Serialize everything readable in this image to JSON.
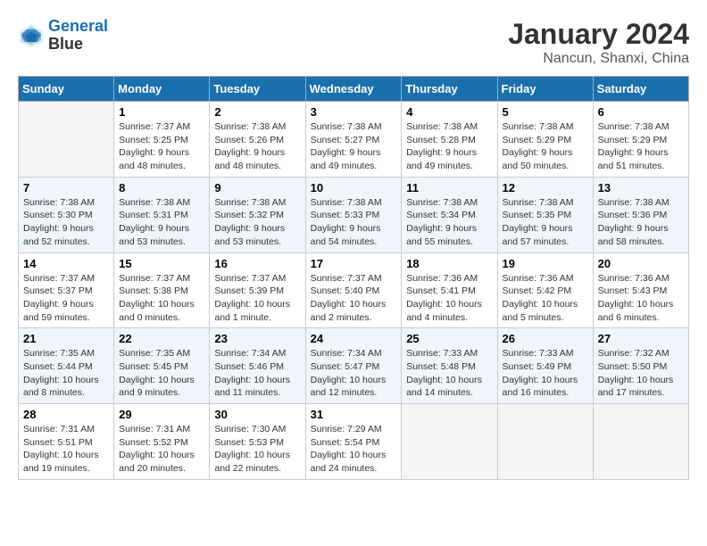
{
  "header": {
    "logo_line1": "General",
    "logo_line2": "Blue",
    "month_year": "January 2024",
    "location": "Nancun, Shanxi, China"
  },
  "days_of_week": [
    "Sunday",
    "Monday",
    "Tuesday",
    "Wednesday",
    "Thursday",
    "Friday",
    "Saturday"
  ],
  "weeks": [
    [
      {
        "day": "",
        "sunrise": "",
        "sunset": "",
        "daylight": "",
        "empty": true
      },
      {
        "day": "1",
        "sunrise": "Sunrise: 7:37 AM",
        "sunset": "Sunset: 5:25 PM",
        "daylight": "Daylight: 9 hours and 48 minutes."
      },
      {
        "day": "2",
        "sunrise": "Sunrise: 7:38 AM",
        "sunset": "Sunset: 5:26 PM",
        "daylight": "Daylight: 9 hours and 48 minutes."
      },
      {
        "day": "3",
        "sunrise": "Sunrise: 7:38 AM",
        "sunset": "Sunset: 5:27 PM",
        "daylight": "Daylight: 9 hours and 49 minutes."
      },
      {
        "day": "4",
        "sunrise": "Sunrise: 7:38 AM",
        "sunset": "Sunset: 5:28 PM",
        "daylight": "Daylight: 9 hours and 49 minutes."
      },
      {
        "day": "5",
        "sunrise": "Sunrise: 7:38 AM",
        "sunset": "Sunset: 5:29 PM",
        "daylight": "Daylight: 9 hours and 50 minutes."
      },
      {
        "day": "6",
        "sunrise": "Sunrise: 7:38 AM",
        "sunset": "Sunset: 5:29 PM",
        "daylight": "Daylight: 9 hours and 51 minutes."
      }
    ],
    [
      {
        "day": "7",
        "sunrise": "Sunrise: 7:38 AM",
        "sunset": "Sunset: 5:30 PM",
        "daylight": "Daylight: 9 hours and 52 minutes."
      },
      {
        "day": "8",
        "sunrise": "Sunrise: 7:38 AM",
        "sunset": "Sunset: 5:31 PM",
        "daylight": "Daylight: 9 hours and 53 minutes."
      },
      {
        "day": "9",
        "sunrise": "Sunrise: 7:38 AM",
        "sunset": "Sunset: 5:32 PM",
        "daylight": "Daylight: 9 hours and 53 minutes."
      },
      {
        "day": "10",
        "sunrise": "Sunrise: 7:38 AM",
        "sunset": "Sunset: 5:33 PM",
        "daylight": "Daylight: 9 hours and 54 minutes."
      },
      {
        "day": "11",
        "sunrise": "Sunrise: 7:38 AM",
        "sunset": "Sunset: 5:34 PM",
        "daylight": "Daylight: 9 hours and 55 minutes."
      },
      {
        "day": "12",
        "sunrise": "Sunrise: 7:38 AM",
        "sunset": "Sunset: 5:35 PM",
        "daylight": "Daylight: 9 hours and 57 minutes."
      },
      {
        "day": "13",
        "sunrise": "Sunrise: 7:38 AM",
        "sunset": "Sunset: 5:36 PM",
        "daylight": "Daylight: 9 hours and 58 minutes."
      }
    ],
    [
      {
        "day": "14",
        "sunrise": "Sunrise: 7:37 AM",
        "sunset": "Sunset: 5:37 PM",
        "daylight": "Daylight: 9 hours and 59 minutes."
      },
      {
        "day": "15",
        "sunrise": "Sunrise: 7:37 AM",
        "sunset": "Sunset: 5:38 PM",
        "daylight": "Daylight: 10 hours and 0 minutes."
      },
      {
        "day": "16",
        "sunrise": "Sunrise: 7:37 AM",
        "sunset": "Sunset: 5:39 PM",
        "daylight": "Daylight: 10 hours and 1 minute."
      },
      {
        "day": "17",
        "sunrise": "Sunrise: 7:37 AM",
        "sunset": "Sunset: 5:40 PM",
        "daylight": "Daylight: 10 hours and 2 minutes."
      },
      {
        "day": "18",
        "sunrise": "Sunrise: 7:36 AM",
        "sunset": "Sunset: 5:41 PM",
        "daylight": "Daylight: 10 hours and 4 minutes."
      },
      {
        "day": "19",
        "sunrise": "Sunrise: 7:36 AM",
        "sunset": "Sunset: 5:42 PM",
        "daylight": "Daylight: 10 hours and 5 minutes."
      },
      {
        "day": "20",
        "sunrise": "Sunrise: 7:36 AM",
        "sunset": "Sunset: 5:43 PM",
        "daylight": "Daylight: 10 hours and 6 minutes."
      }
    ],
    [
      {
        "day": "21",
        "sunrise": "Sunrise: 7:35 AM",
        "sunset": "Sunset: 5:44 PM",
        "daylight": "Daylight: 10 hours and 8 minutes."
      },
      {
        "day": "22",
        "sunrise": "Sunrise: 7:35 AM",
        "sunset": "Sunset: 5:45 PM",
        "daylight": "Daylight: 10 hours and 9 minutes."
      },
      {
        "day": "23",
        "sunrise": "Sunrise: 7:34 AM",
        "sunset": "Sunset: 5:46 PM",
        "daylight": "Daylight: 10 hours and 11 minutes."
      },
      {
        "day": "24",
        "sunrise": "Sunrise: 7:34 AM",
        "sunset": "Sunset: 5:47 PM",
        "daylight": "Daylight: 10 hours and 12 minutes."
      },
      {
        "day": "25",
        "sunrise": "Sunrise: 7:33 AM",
        "sunset": "Sunset: 5:48 PM",
        "daylight": "Daylight: 10 hours and 14 minutes."
      },
      {
        "day": "26",
        "sunrise": "Sunrise: 7:33 AM",
        "sunset": "Sunset: 5:49 PM",
        "daylight": "Daylight: 10 hours and 16 minutes."
      },
      {
        "day": "27",
        "sunrise": "Sunrise: 7:32 AM",
        "sunset": "Sunset: 5:50 PM",
        "daylight": "Daylight: 10 hours and 17 minutes."
      }
    ],
    [
      {
        "day": "28",
        "sunrise": "Sunrise: 7:31 AM",
        "sunset": "Sunset: 5:51 PM",
        "daylight": "Daylight: 10 hours and 19 minutes."
      },
      {
        "day": "29",
        "sunrise": "Sunrise: 7:31 AM",
        "sunset": "Sunset: 5:52 PM",
        "daylight": "Daylight: 10 hours and 20 minutes."
      },
      {
        "day": "30",
        "sunrise": "Sunrise: 7:30 AM",
        "sunset": "Sunset: 5:53 PM",
        "daylight": "Daylight: 10 hours and 22 minutes."
      },
      {
        "day": "31",
        "sunrise": "Sunrise: 7:29 AM",
        "sunset": "Sunset: 5:54 PM",
        "daylight": "Daylight: 10 hours and 24 minutes."
      },
      {
        "day": "",
        "sunrise": "",
        "sunset": "",
        "daylight": "",
        "empty": true
      },
      {
        "day": "",
        "sunrise": "",
        "sunset": "",
        "daylight": "",
        "empty": true
      },
      {
        "day": "",
        "sunrise": "",
        "sunset": "",
        "daylight": "",
        "empty": true
      }
    ]
  ]
}
